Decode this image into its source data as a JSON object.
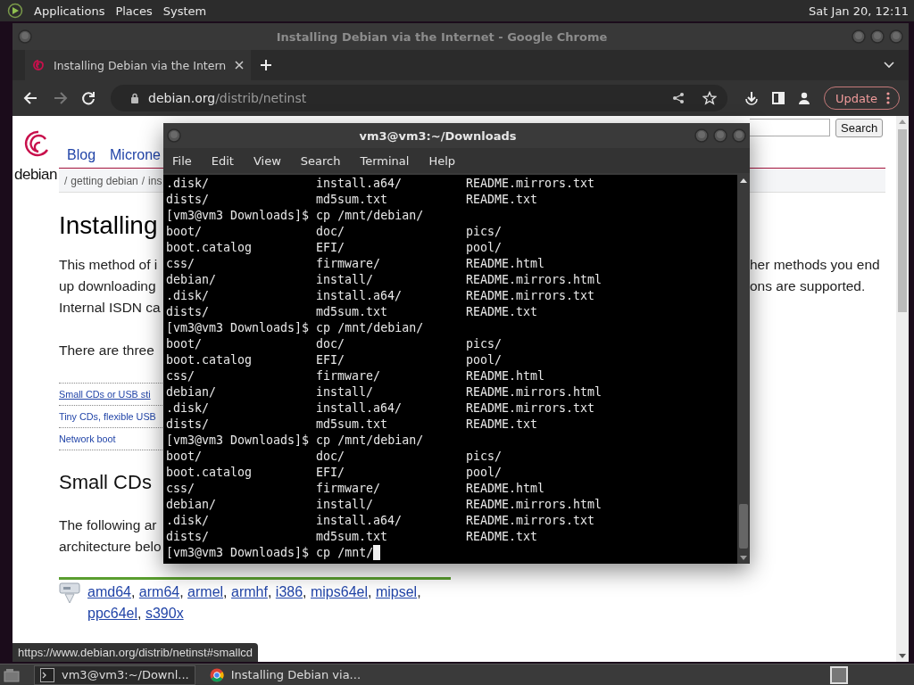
{
  "top_panel": {
    "menus": [
      "Applications",
      "Places",
      "System"
    ],
    "clock": "Sat Jan 20, 12:11"
  },
  "browser": {
    "title": "Installing Debian via the Internet - Google Chrome",
    "tabs": [
      {
        "label": "Installing Debian via the Intern",
        "selected": true
      }
    ],
    "nav_buttons": [
      {
        "kind": "back",
        "disabled": false
      },
      {
        "kind": "forward",
        "disabled": true
      },
      {
        "kind": "reload",
        "disabled": false
      }
    ],
    "address": {
      "host": "debian.org",
      "path": "/distrib/netinst"
    },
    "update_button": "Update"
  },
  "page": {
    "logo_text": "debian",
    "nav": [
      "Blog",
      "Microne"
    ],
    "search_button": "Search",
    "breadcrumb": {
      "separator": "/",
      "items": [
        "getting debian",
        "ins"
      ]
    },
    "heading": "Installing",
    "intro_lines": [
      {
        "left": "This method of i",
        "right": "her methods you end"
      },
      {
        "left": "up downloading",
        "right": "ons are supported."
      },
      {
        "left": "Internal ISDN ca"
      }
    ],
    "three_line": "There are three",
    "toc_links": [
      "Small CDs or USB sti",
      "Tiny CDs, flexible USB",
      "Network boot"
    ],
    "section_heading": "Small CDs",
    "section_lines": [
      "The following ar",
      "architecture belo"
    ],
    "arch_links": [
      {
        "label": "amd64",
        "after": ","
      },
      {
        "label": "arm64",
        "after": ","
      },
      {
        "label": "armel",
        "after": ","
      },
      {
        "label": "armhf",
        "after": ","
      },
      {
        "label": "i386",
        "after": ","
      },
      {
        "label": "mips64el",
        "after": ","
      },
      {
        "label": "mipsel",
        "after": ","
      },
      {
        "label": "ppc64el",
        "after": ","
      },
      {
        "label": "s390x"
      }
    ],
    "status_url": "https://www.debian.org/distrib/netinst#smallcd"
  },
  "terminal": {
    "title": "vm3@vm3:~/Downloads",
    "menus": [
      "File",
      "Edit",
      "View",
      "Search",
      "Terminal",
      "Help"
    ],
    "lines": [
      {
        "kind": "listing",
        "cells": [
          ".disk/",
          "install.a64/",
          "README.mirrors.txt"
        ]
      },
      {
        "kind": "listing",
        "cells": [
          "dists/",
          "md5sum.txt",
          "README.txt"
        ]
      },
      {
        "kind": "prompt",
        "text": "[vm3@vm3 Downloads]$ cp /mnt/debian/"
      },
      {
        "kind": "listing",
        "cells": [
          "boot/",
          "doc/",
          "pics/"
        ]
      },
      {
        "kind": "listing",
        "cells": [
          "boot.catalog",
          "EFI/",
          "pool/"
        ]
      },
      {
        "kind": "listing",
        "cells": [
          "css/",
          "firmware/",
          "README.html"
        ]
      },
      {
        "kind": "listing",
        "cells": [
          "debian/",
          "install/",
          "README.mirrors.html"
        ]
      },
      {
        "kind": "listing",
        "cells": [
          ".disk/",
          "install.a64/",
          "README.mirrors.txt"
        ]
      },
      {
        "kind": "listing",
        "cells": [
          "dists/",
          "md5sum.txt",
          "README.txt"
        ]
      },
      {
        "kind": "prompt",
        "text": "[vm3@vm3 Downloads]$ cp /mnt/debian/"
      },
      {
        "kind": "listing",
        "cells": [
          "boot/",
          "doc/",
          "pics/"
        ]
      },
      {
        "kind": "listing",
        "cells": [
          "boot.catalog",
          "EFI/",
          "pool/"
        ]
      },
      {
        "kind": "listing",
        "cells": [
          "css/",
          "firmware/",
          "README.html"
        ]
      },
      {
        "kind": "listing",
        "cells": [
          "debian/",
          "install/",
          "README.mirrors.html"
        ]
      },
      {
        "kind": "listing",
        "cells": [
          ".disk/",
          "install.a64/",
          "README.mirrors.txt"
        ]
      },
      {
        "kind": "listing",
        "cells": [
          "dists/",
          "md5sum.txt",
          "README.txt"
        ]
      },
      {
        "kind": "prompt",
        "text": "[vm3@vm3 Downloads]$ cp /mnt/debian/"
      },
      {
        "kind": "listing",
        "cells": [
          "boot/",
          "doc/",
          "pics/"
        ]
      },
      {
        "kind": "listing",
        "cells": [
          "boot.catalog",
          "EFI/",
          "pool/"
        ]
      },
      {
        "kind": "listing",
        "cells": [
          "css/",
          "firmware/",
          "README.html"
        ]
      },
      {
        "kind": "listing",
        "cells": [
          "debian/",
          "install/",
          "README.mirrors.html"
        ]
      },
      {
        "kind": "listing",
        "cells": [
          ".disk/",
          "install.a64/",
          "README.mirrors.txt"
        ]
      },
      {
        "kind": "listing",
        "cells": [
          "dists/",
          "md5sum.txt",
          "README.txt"
        ]
      },
      {
        "kind": "prompt",
        "text": "[vm3@vm3 Downloads]$ cp /mnt/",
        "cursor": true
      }
    ]
  },
  "taskbar": {
    "tasks": [
      {
        "kind": "terminal",
        "label": "vm3@vm3:~/Downl...",
        "selected": true
      },
      {
        "kind": "browser",
        "label": "Installing Debian via...",
        "selected": false
      }
    ]
  }
}
